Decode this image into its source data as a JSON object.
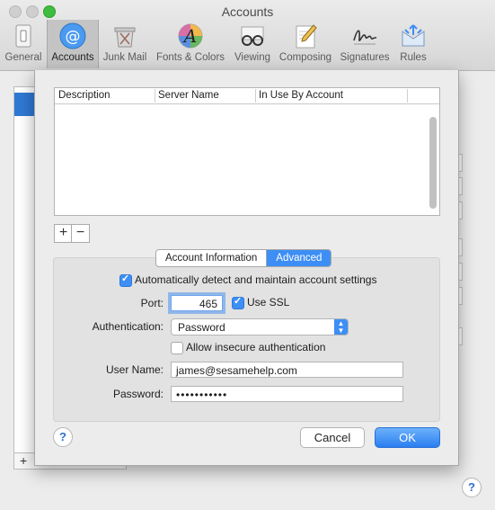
{
  "window": {
    "title": "Accounts"
  },
  "toolbar": {
    "items": [
      {
        "label": "General",
        "icon": "general-switch-icon"
      },
      {
        "label": "Accounts",
        "icon": "at-sign-icon",
        "selected": true
      },
      {
        "label": "Junk Mail",
        "icon": "junk-mail-icon"
      },
      {
        "label": "Fonts & Colors",
        "icon": "fonts-colors-icon"
      },
      {
        "label": "Viewing",
        "icon": "glasses-icon"
      },
      {
        "label": "Composing",
        "icon": "pencil-paper-icon"
      },
      {
        "label": "Signatures",
        "icon": "signature-icon"
      },
      {
        "label": "Rules",
        "icon": "rules-icon"
      }
    ]
  },
  "server_table": {
    "columns": [
      "Description",
      "Server Name",
      "In Use By Account"
    ],
    "rows": []
  },
  "list_buttons": {
    "add": "+",
    "remove": "−"
  },
  "tabs": [
    {
      "label": "Account Information",
      "active": false
    },
    {
      "label": "Advanced",
      "active": true
    }
  ],
  "advanced": {
    "auto_detect": {
      "label": "Automatically detect and maintain account settings",
      "checked": true
    },
    "port": {
      "label": "Port:",
      "value": "465"
    },
    "use_ssl": {
      "label": "Use SSL",
      "checked": true
    },
    "authentication": {
      "label": "Authentication:",
      "value": "Password"
    },
    "allow_insecure": {
      "label": "Allow insecure authentication",
      "checked": false
    },
    "user_name": {
      "label": "User Name:",
      "value": "james@sesamehelp.com"
    },
    "password": {
      "label": "Password:",
      "value": "•••••••••••"
    }
  },
  "buttons": {
    "help": "?",
    "cancel": "Cancel",
    "ok": "OK"
  },
  "background": {
    "help": "?",
    "add": "+"
  },
  "colors": {
    "accent": "#3d8ef5",
    "selection": "#2f79d3"
  }
}
